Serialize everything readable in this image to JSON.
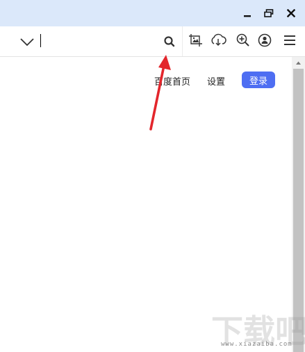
{
  "window": {
    "controls": {
      "minimize_icon": "minimize-icon",
      "restore_icon": "restore-icon",
      "close_icon": "close-icon"
    }
  },
  "toolbar": {
    "address_value": "",
    "icons": [
      "chevron-down-icon",
      "search-icon",
      "screenshot-icon",
      "download-icon",
      "zoom-in-icon",
      "user-icon",
      "menu-icon"
    ]
  },
  "page": {
    "links": {
      "home": "百度首页",
      "settings": "设置"
    },
    "login_label": "登录"
  },
  "watermark": {
    "text": "下载吧",
    "subtext": "www.xiazaiba.com"
  },
  "colors": {
    "titlebar": "#dbe8fa",
    "login_button": "#4e6ef2",
    "annotation_arrow": "#e3262c"
  }
}
